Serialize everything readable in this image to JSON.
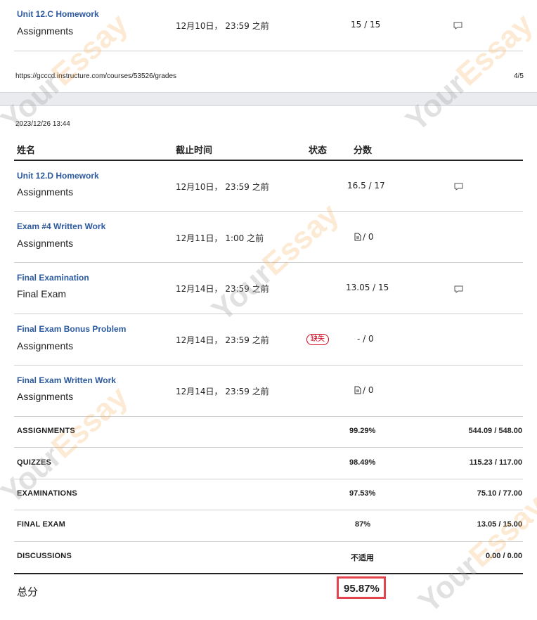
{
  "top_row": {
    "title": "Unit 12.C Homework",
    "category": "Assignments",
    "due": "12月10日， 23:59 之前",
    "score": "15 / 15"
  },
  "page1_footer": {
    "url": "https://gcccd.instructure.com/courses/53526/grades",
    "page": "4/5"
  },
  "page2_header": {
    "timestamp": "2023/12/26 13:44"
  },
  "table_header": {
    "name": "姓名",
    "due": "截止时间",
    "status": "状态",
    "score": "分数"
  },
  "rows": [
    {
      "title": "Unit 12.D Homework",
      "category": "Assignments",
      "due": "12月10日， 23:59 之前",
      "status": "",
      "score": "16.5 / 17",
      "score_icon": false,
      "comment_icon": true
    },
    {
      "title": "Exam #4 Written Work",
      "category": "Assignments",
      "due": "12月11日， 1:00 之前",
      "status": "",
      "score": "/ 0",
      "score_icon": true,
      "comment_icon": false
    },
    {
      "title": "Final Examination",
      "category": "Final Exam",
      "due": "12月14日， 23:59 之前",
      "status": "",
      "score": "13.05 / 15",
      "score_icon": false,
      "comment_icon": true
    },
    {
      "title": "Final Exam Bonus Problem",
      "category": "Assignments",
      "due": "12月14日， 23:59 之前",
      "status": "缺失",
      "score": "- / 0",
      "score_icon": false,
      "comment_icon": false
    },
    {
      "title": "Final Exam Written Work",
      "category": "Assignments",
      "due": "12月14日， 23:59 之前",
      "status": "",
      "score": "/ 0",
      "score_icon": true,
      "comment_icon": false
    }
  ],
  "summary": [
    {
      "label": "ASSIGNMENTS",
      "percent": "99.29%",
      "points": "544.09 / 548.00"
    },
    {
      "label": "QUIZZES",
      "percent": "98.49%",
      "points": "115.23 / 117.00"
    },
    {
      "label": "EXAMINATIONS",
      "percent": "97.53%",
      "points": "75.10 / 77.00"
    },
    {
      "label": "FINAL EXAM",
      "percent": "87%",
      "points": "13.05 / 15.00"
    },
    {
      "label": "DISCUSSIONS",
      "percent": "不适用",
      "points": "0.00 / 0.00"
    }
  ],
  "total": {
    "label": "总分",
    "value": "95.87%"
  },
  "watermark": {
    "brand_prefix": "Your",
    "brand_suffix": "Essay"
  },
  "colors": {
    "link_blue": "#2d5a9e",
    "missing_red": "#d0021b",
    "highlight_box": "#e2454f",
    "watermark_orange": "#f5a03c"
  }
}
